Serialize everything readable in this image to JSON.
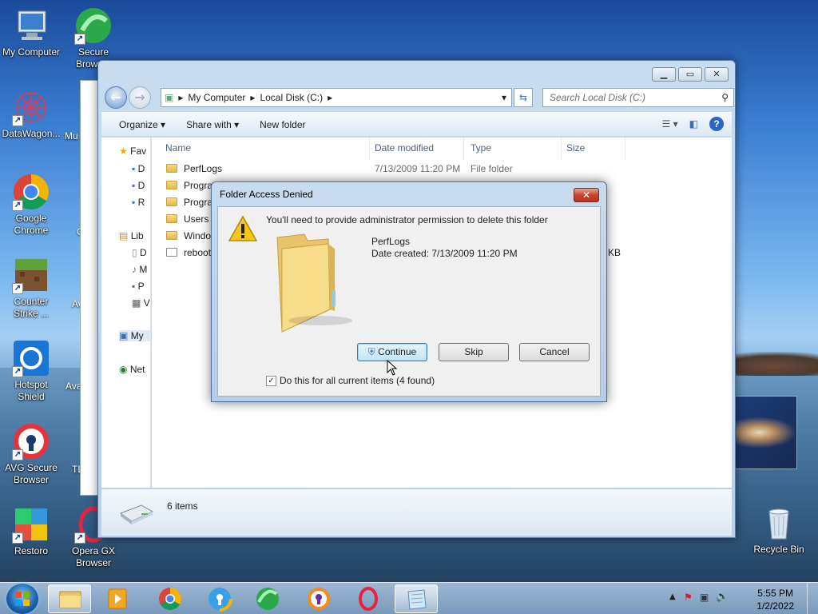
{
  "desktop": {
    "icons_left": [
      {
        "label": "My Computer",
        "icon": "computer-icon"
      },
      {
        "label": "DataWagon...",
        "icon": "datawagon-icon"
      },
      {
        "label": "Google Chrome",
        "icon": "chrome-icon"
      },
      {
        "label": "Counter Strike ...",
        "icon": "minecraft-icon"
      },
      {
        "label": "Hotspot Shield",
        "icon": "hotspot-shield-icon"
      },
      {
        "label": "AVG Secure Browser",
        "icon": "avg-browser-icon"
      },
      {
        "label": "Restoro",
        "icon": "restoro-icon"
      }
    ],
    "icons_col2": [
      {
        "label": "Secure Browser",
        "icon": "secure-browser-icon"
      },
      {
        "label": "Opera GX Browser",
        "icon": "opera-gx-icon"
      }
    ],
    "recycle_bin": "Recycle Bin",
    "partials": [
      "Mu",
      "G",
      "Av A",
      "Ava E",
      "TL"
    ]
  },
  "explorer": {
    "address": {
      "items": [
        "My Computer",
        "Local Disk (C:)"
      ]
    },
    "search_placeholder": "Search Local Disk (C:)",
    "toolbar": {
      "organize": "Organize",
      "share_with": "Share with",
      "new_folder": "New folder"
    },
    "nav": [
      "Fav",
      "D",
      "D",
      "R",
      "Lib",
      "D",
      "M",
      "P",
      "V",
      "My",
      "Net"
    ],
    "columns": {
      "name": "Name",
      "date": "Date modified",
      "type": "Type",
      "size": "Size"
    },
    "files": [
      {
        "name": "PerfLogs",
        "date": "7/13/2009 11:20 PM",
        "type": "File folder"
      },
      {
        "name": "Progra",
        "date": "",
        "type": ""
      },
      {
        "name": "Progra",
        "date": "",
        "type": ""
      },
      {
        "name": "Users",
        "date": "",
        "type": ""
      },
      {
        "name": "Windo",
        "date": "",
        "type": ""
      },
      {
        "name": "reboot",
        "date": "",
        "type": ""
      }
    ],
    "size_partial": "KB",
    "status": "6 items"
  },
  "dialog": {
    "title": "Folder Access Denied",
    "message": "You'll need to provide administrator permission to delete this folder",
    "folder_name": "PerfLogs",
    "date_created": "Date created: 7/13/2009 11:20 PM",
    "buttons": {
      "continue": "Continue",
      "skip": "Skip",
      "cancel": "Cancel"
    },
    "checkbox_label": "Do this for all current items (4 found)",
    "checkbox_checked": true
  },
  "taskbar": {
    "clock_time": "5:55 PM",
    "clock_date": "1/2/2022"
  }
}
